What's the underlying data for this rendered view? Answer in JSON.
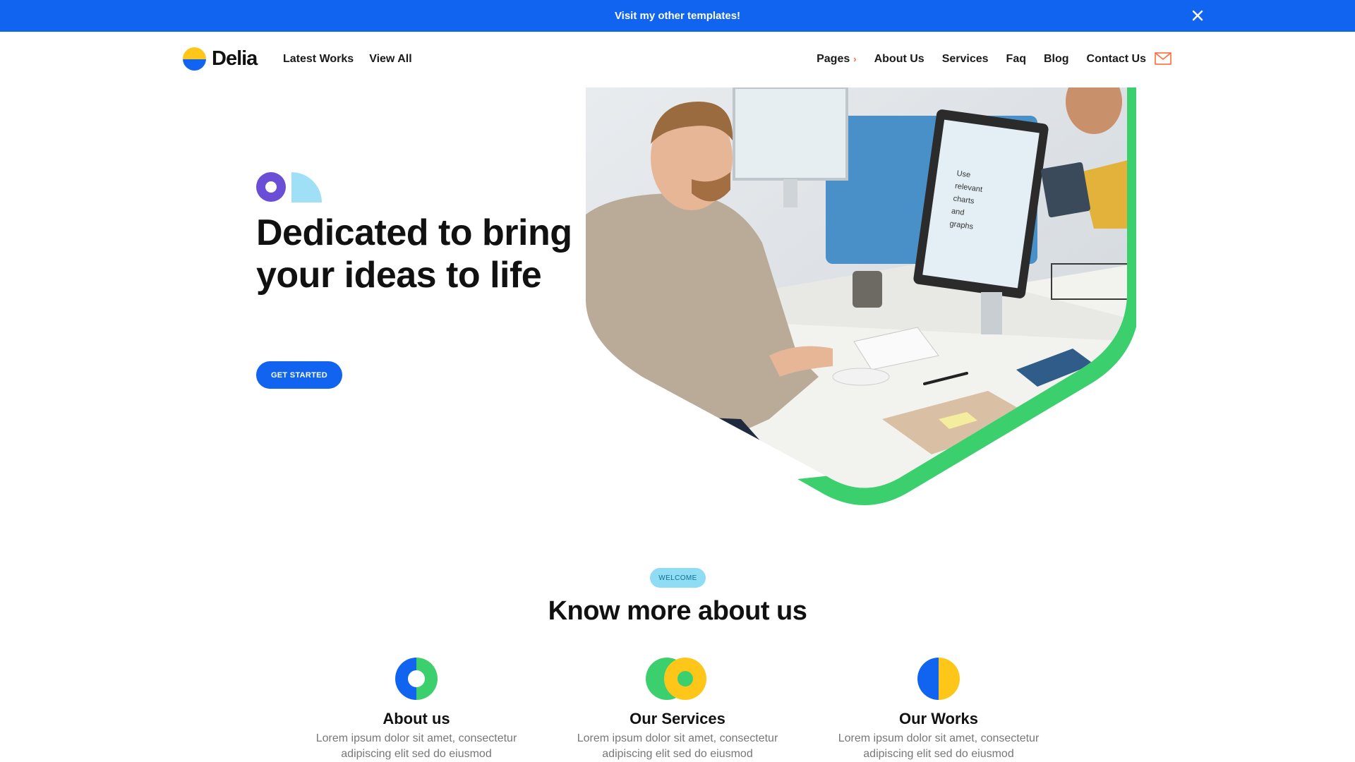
{
  "promo": {
    "text": "Visit my other templates!",
    "close_icon": "close-icon"
  },
  "brand": {
    "name": "Delia",
    "colors": {
      "yellow": "#ffc61a",
      "blue": "#1064f0"
    }
  },
  "nav": {
    "left": [
      "Latest Works",
      "View All"
    ],
    "right": [
      "Pages",
      "About Us",
      "Services",
      "Faq",
      "Blog",
      "Contact Us"
    ],
    "pages_chevron": "›",
    "mail_icon": "mail-icon"
  },
  "hero": {
    "title": "Dedicated to bring your ideas to life",
    "cta": "GET STARTED",
    "image": "office-worker-photo",
    "accent_color": "#3ccf6e"
  },
  "about": {
    "badge": "WELCOME",
    "title": "Know more about us",
    "features": [
      {
        "icon": "donut-icon",
        "title": "About us",
        "text": "Lorem ipsum dolor sit amet, consectetur adipiscing elit sed do eiusmod"
      },
      {
        "icon": "overlapping-circles-icon",
        "title": "Our Services",
        "text": "Lorem ipsum dolor sit amet, consectetur adipiscing elit sed do eiusmod"
      },
      {
        "icon": "split-circle-icon",
        "title": "Our Works",
        "text": "Lorem ipsum dolor sit amet, consectetur adipiscing elit sed do eiusmod"
      }
    ]
  },
  "colors": {
    "primary": "#1064f0",
    "green": "#3ccf6e",
    "yellow": "#ffc61a",
    "purple": "#6a4fd6",
    "light_blue": "#8fdcf5"
  }
}
